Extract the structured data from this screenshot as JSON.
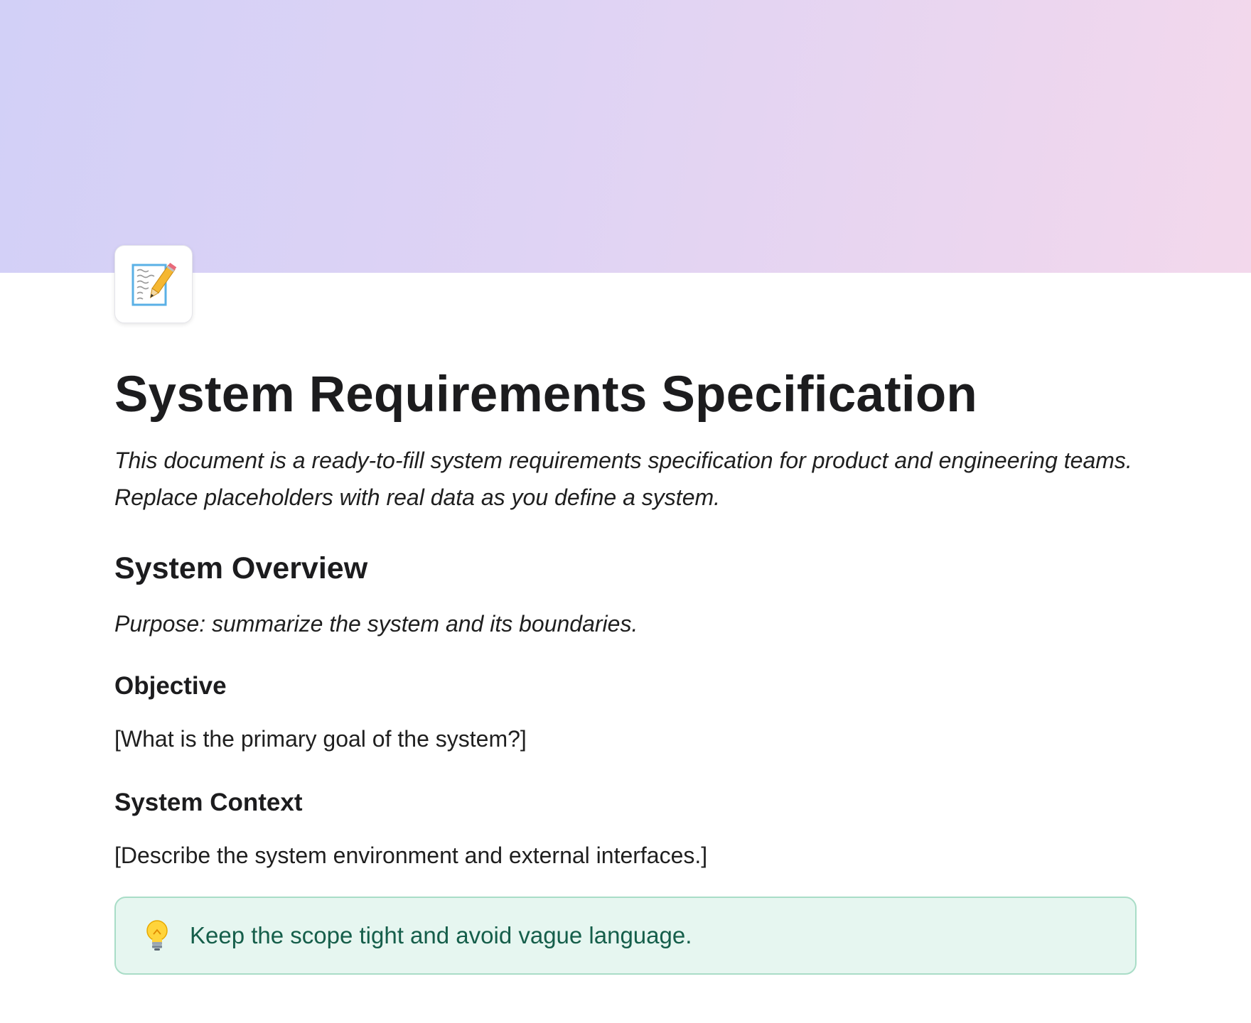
{
  "document": {
    "title": "System Requirements Specification",
    "intro": "This document is a ready-to-fill system requirements specification for product and engineering teams. Replace placeholders with real data as you define a system.",
    "page_icon": "memo-icon"
  },
  "sections": {
    "overview": {
      "heading": "System Overview",
      "purpose": "Purpose: summarize the system and its boundaries.",
      "objective": {
        "heading": "Objective",
        "text": "[What is the primary goal of the system?]"
      },
      "context": {
        "heading": "System Context",
        "text": "[Describe the system environment and external interfaces.]"
      }
    }
  },
  "callout": {
    "icon": "lightbulb-icon",
    "text": "Keep the scope tight and avoid vague language.",
    "background": "#e6f6f0",
    "border": "#a9ddc7",
    "text_color": "#155e4a"
  },
  "cover": {
    "gradient_start": "#d2d0f7",
    "gradient_end": "#f3d8ec"
  }
}
